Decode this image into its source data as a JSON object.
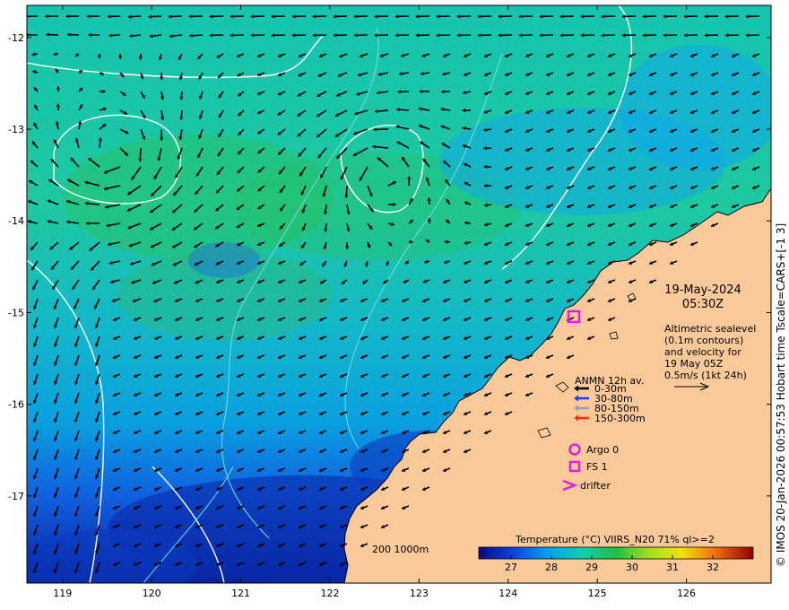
{
  "map": {
    "x_ticks": [
      "119",
      "120",
      "121",
      "122",
      "123",
      "124",
      "125",
      "126"
    ],
    "y_ticks": [
      "-12",
      "-13",
      "-14",
      "-15",
      "-16",
      "-17"
    ],
    "lon_range": [
      118.6,
      126.95
    ],
    "lat_range": [
      -17.95,
      -11.65
    ]
  },
  "annotation": {
    "date": "19-May-2024",
    "time": "05:30Z",
    "desc_lines": [
      "Altimetric sealevel",
      "(0.1m contours)",
      "and velocity for",
      "19 May 05Z",
      "0.5m/s (1kt 24h)"
    ]
  },
  "legend": {
    "title": "ANMN 12h av.",
    "items": [
      {
        "label": "0-30m",
        "color": "#000000"
      },
      {
        "label": "30-80m",
        "color": "#1e3cff"
      },
      {
        "label": "80-150m",
        "color": "#9aa0a6"
      },
      {
        "label": "150-300m",
        "color": "#ff2a10"
      }
    ],
    "argo": "Argo 0",
    "fs": "FS 1",
    "drifter": "drifter",
    "marker_color": "#e020e0"
  },
  "depth_legend": "200  1000m",
  "colorbar": {
    "title": "Temperature (°C) VIIRS_N20 71% ql>=2",
    "ticks": [
      "27",
      "28",
      "29",
      "30",
      "31",
      "32"
    ],
    "range": [
      26.2,
      33
    ]
  },
  "side_caption": "© IMOS 20-Jan-2026 00:57:53 Hobart time Tscale=CARS+[-1 3]",
  "colors": {
    "land": "#f9c99a",
    "contour": "#ffffff",
    "isobath": "#6fe0e0"
  }
}
